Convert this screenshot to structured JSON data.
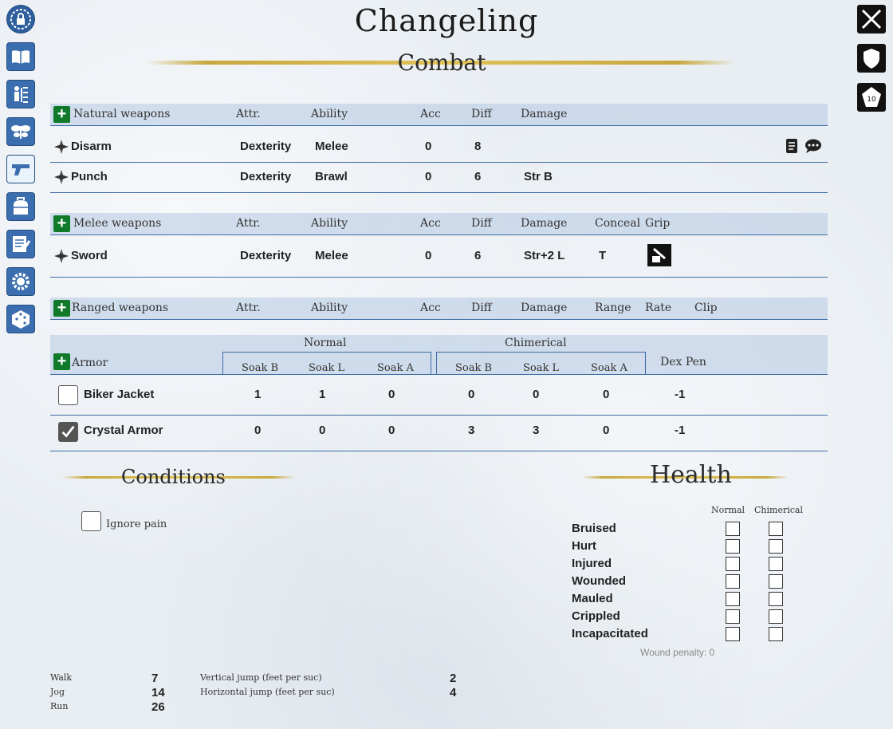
{
  "title": "Changeling",
  "combat_title": "Combat",
  "natural": {
    "header": {
      "label": "Natural weapons",
      "attr": "Attr.",
      "ability": "Ability",
      "acc": "Acc",
      "diff": "Diff",
      "damage": "Damage"
    },
    "rows": [
      {
        "name": "Disarm",
        "attr": "Dexterity",
        "ability": "Melee",
        "acc": "0",
        "diff": "8",
        "damage": ""
      },
      {
        "name": "Punch",
        "attr": "Dexterity",
        "ability": "Brawl",
        "acc": "0",
        "diff": "6",
        "damage": "Str B"
      }
    ]
  },
  "melee": {
    "header": {
      "label": "Melee weapons",
      "attr": "Attr.",
      "ability": "Ability",
      "acc": "Acc",
      "diff": "Diff",
      "damage": "Damage",
      "conceal": "Conceal",
      "grip": "Grip"
    },
    "rows": [
      {
        "name": "Sword",
        "attr": "Dexterity",
        "ability": "Melee",
        "acc": "0",
        "diff": "6",
        "damage": "Str+2 L",
        "conceal": "T"
      }
    ]
  },
  "ranged": {
    "header": {
      "label": "Ranged weapons",
      "attr": "Attr.",
      "ability": "Ability",
      "acc": "Acc",
      "diff": "Diff",
      "damage": "Damage",
      "range": "Range",
      "rate": "Rate",
      "clip": "Clip"
    }
  },
  "armor": {
    "header": {
      "label": "Armor",
      "normal": "Normal",
      "chimerical": "Chimerical",
      "soak_b": "Soak B",
      "soak_l": "Soak L",
      "soak_a": "Soak A",
      "dex_pen": "Dex Pen"
    },
    "rows": [
      {
        "name": "Biker Jacket",
        "checked": false,
        "nb": "1",
        "nl": "1",
        "na": "0",
        "cb": "0",
        "cl": "0",
        "ca": "0",
        "dex": "-1"
      },
      {
        "name": "Crystal Armor",
        "checked": true,
        "nb": "0",
        "nl": "0",
        "na": "0",
        "cb": "3",
        "cl": "3",
        "ca": "0",
        "dex": "-1"
      }
    ]
  },
  "conditions": {
    "title": "Conditions",
    "ignore_pain": "Ignore pain"
  },
  "health": {
    "title": "Health",
    "col_normal": "Normal",
    "col_chimerical": "Chimerical",
    "levels": [
      "Bruised",
      "Hurt",
      "Injured",
      "Wounded",
      "Mauled",
      "Crippled",
      "Incapacitated"
    ],
    "wound_penalty": "Wound penalty: 0"
  },
  "movement": {
    "walk_label": "Walk",
    "walk": "7",
    "jog_label": "Jog",
    "jog": "14",
    "run_label": "Run",
    "run": "26",
    "vjump_label": "Vertical jump (feet per suc)",
    "vjump": "2",
    "hjump_label": "Horizontal jump (feet per suc)",
    "hjump": "4"
  },
  "sidebar_icons": [
    "lock-icon",
    "book-icon",
    "skill-tree-icon",
    "fairy-icon",
    "gun-icon",
    "bag-icon",
    "notes-icon",
    "gear-icon",
    "dice-icon"
  ],
  "right_icons": [
    "crossed-swords-icon",
    "shield-icon",
    "d10-dice-icon"
  ],
  "colors": {
    "accent": "#3a6eae",
    "plus": "#117a2a",
    "gold": "#c8a83c"
  }
}
